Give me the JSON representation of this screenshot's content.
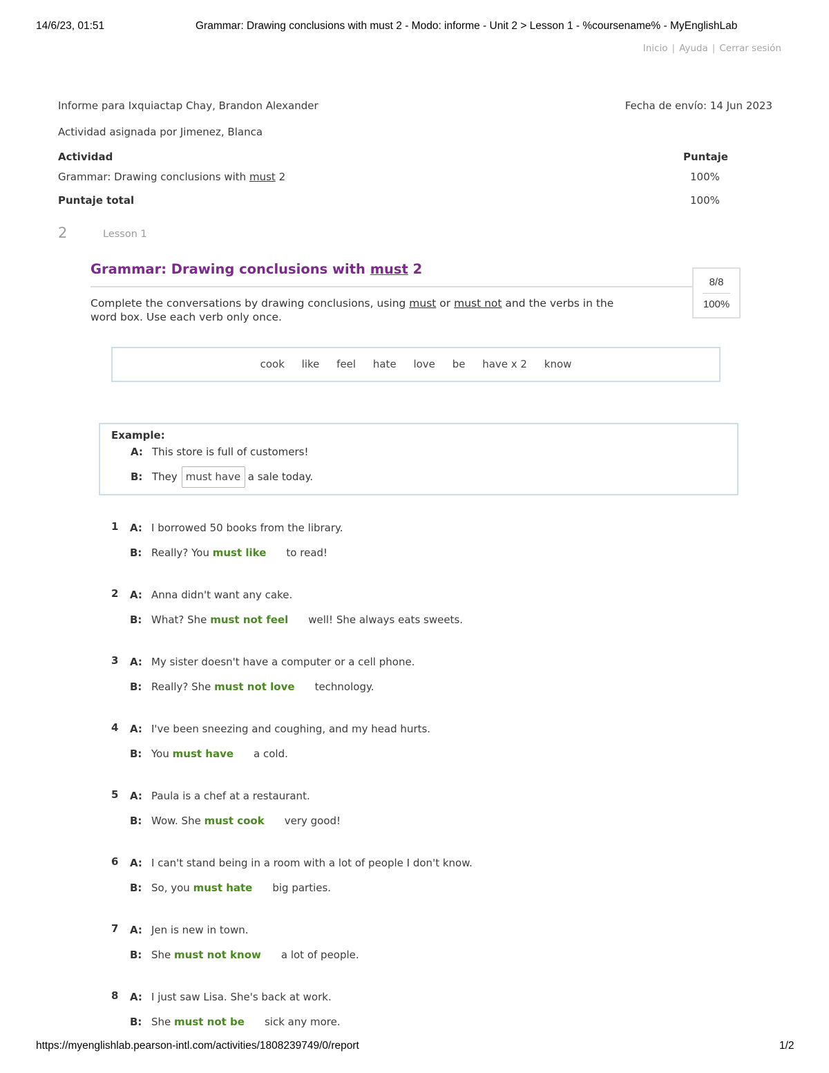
{
  "print_header": {
    "datetime": "14/6/23, 01:51",
    "page_title": "Grammar: Drawing conclusions with must 2 - Modo: informe - Unit 2 > Lesson 1 - %coursename% - MyEnglishLab"
  },
  "top_links": [
    {
      "label": "Inicio"
    },
    {
      "label": "Ayuda"
    },
    {
      "label": "Cerrar sesión"
    }
  ],
  "report": {
    "student_line": "Informe para Ixquiactap Chay, Brandon Alexander",
    "date_sent": "Fecha de envío: 14 Jun 2023",
    "assigned_by": "Actividad asignada por Jimenez, Blanca",
    "header_activity": "Actividad",
    "header_score": "Puntaje",
    "activity_name_prefix": "Grammar: Drawing conclusions with ",
    "activity_name_underlined": "must",
    "activity_name_suffix": " 2",
    "activity_score": "100%",
    "total_label": "Puntaje total",
    "total_score": "100%"
  },
  "unit": {
    "number": "2",
    "lesson": "Lesson 1"
  },
  "activity": {
    "title_prefix": "Grammar: Drawing conclusions with ",
    "title_underlined": "must",
    "title_suffix": " 2",
    "score_fraction": "8/8",
    "score_percent": "100%",
    "instructions": {
      "part1": "Complete the conversations by drawing conclusions, using ",
      "u1": "must",
      "part2": " or ",
      "u2": "must not",
      "part3": " and the verbs in the word box. Use each verb only once."
    },
    "word_box": [
      "cook",
      "like",
      "feel",
      "hate",
      "love",
      "be",
      "have x 2",
      "know"
    ],
    "example": {
      "label": "Example:",
      "a_label": "A:",
      "a_text": "This store is full of customers!",
      "b_label": "B:",
      "b_before": "They",
      "b_answer": "must have",
      "b_after": "a sale today."
    },
    "questions": [
      {
        "num": "1",
        "a_label": "A:",
        "a_text": "I borrowed 50 books from the library.",
        "b_label": "B:",
        "b_before": "Really? You",
        "answer": "must like",
        "b_after": "to read!"
      },
      {
        "num": "2",
        "a_label": "A:",
        "a_text": "Anna didn't want any cake.",
        "b_label": "B:",
        "b_before": "What? She",
        "answer": "must not feel",
        "b_after": "well! She always eats sweets."
      },
      {
        "num": "3",
        "a_label": "A:",
        "a_text": "My sister doesn't have a computer or a cell phone.",
        "b_label": "B:",
        "b_before": "Really? She",
        "answer": "must not love",
        "b_after": "technology."
      },
      {
        "num": "4",
        "a_label": "A:",
        "a_text": "I've been sneezing and coughing, and my head hurts.",
        "b_label": "B:",
        "b_before": "You",
        "answer": "must have",
        "b_after": "a cold."
      },
      {
        "num": "5",
        "a_label": "A:",
        "a_text": "Paula is a chef at a restaurant.",
        "b_label": "B:",
        "b_before": "Wow. She",
        "answer": "must cook",
        "b_after": "very good!"
      },
      {
        "num": "6",
        "a_label": "A:",
        "a_text": "I can't stand being in a room with a lot of people I don't know.",
        "b_label": "B:",
        "b_before": "So, you",
        "answer": "must hate",
        "b_after": "big parties."
      },
      {
        "num": "7",
        "a_label": "A:",
        "a_text": "Jen is new in town.",
        "b_label": "B:",
        "b_before": "She",
        "answer": "must not know",
        "b_after": "a lot of people."
      },
      {
        "num": "8",
        "a_label": "A:",
        "a_text": "I just saw Lisa. She's back at work.",
        "b_label": "B:",
        "b_before": "She",
        "answer": "must not be",
        "b_after": "sick any more."
      }
    ]
  },
  "colors": {
    "title_purple": "#7b2a8c",
    "answer_green": "#4a8a20",
    "box_border": "#cddde8"
  },
  "print_footer": {
    "url": "https://myenglishlab.pearson-intl.com/activities/1808239749/0/report",
    "page": "1/2"
  }
}
